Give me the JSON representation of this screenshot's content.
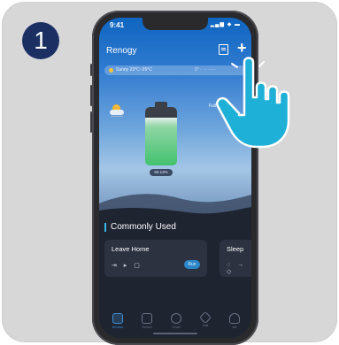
{
  "step": {
    "number": "1"
  },
  "status_bar": {
    "time": "9:41",
    "icons": "▂▄▆ ◆ ▬"
  },
  "header": {
    "title": "Renogy",
    "doc_icon": "document-icon",
    "add_icon": "plus-icon"
  },
  "weather": {
    "text": "Sunny 23°C~25°C",
    "text2": "0° · ··· ·····"
  },
  "side_label": "Full",
  "battery": {
    "label": "50.13%"
  },
  "commonly_used": {
    "title": "Commonly Used",
    "tiles": [
      {
        "name": "Leave Home",
        "icons": "⇥ ▸ ▢",
        "run_label": "Run"
      },
      {
        "name": "Sleep",
        "icons": "◌ → ◇"
      }
    ]
  },
  "bottom_nav": [
    {
      "label": "Devices",
      "icon": "devices-icon",
      "active": true
    },
    {
      "label": "Scenes",
      "icon": "scenes-icon",
      "active": false
    },
    {
      "label": "Smart",
      "icon": "smart-icon",
      "active": false
    },
    {
      "label": "Mall",
      "icon": "mall-icon",
      "active": false
    },
    {
      "label": "Me",
      "icon": "me-icon",
      "active": false
    }
  ],
  "colors": {
    "badge": "#1b2f63",
    "hand": "#1fb0d8",
    "accent": "#2b86c9"
  }
}
